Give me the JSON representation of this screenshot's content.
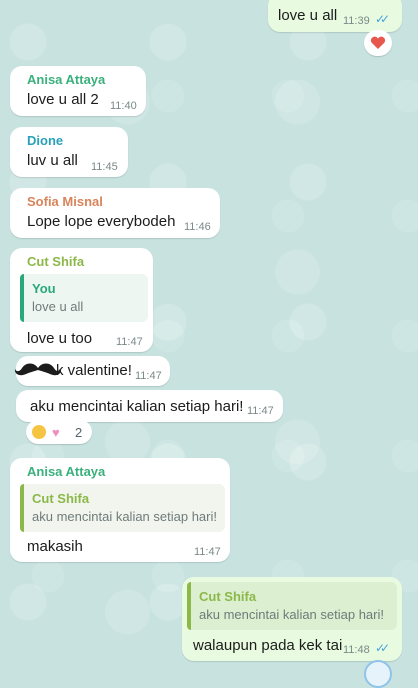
{
  "colors": {
    "wallpaper": "#c7e2df",
    "incoming_bubble": "#ffffff",
    "outgoing_bubble": "#e8fbe0",
    "anisa": "#3bb07c",
    "dione": "#2aa1b8",
    "sofia": "#d8845a",
    "cut_shifa": "#8cb84a",
    "you_quote": "#29a97b",
    "read_ticks": "#4aa3df"
  },
  "messages": [
    {
      "direction": "outgoing",
      "text": "love u all",
      "time": "11:39",
      "ticks": "read",
      "reaction": "heart"
    },
    {
      "direction": "incoming",
      "sender": "Anisa Attaya",
      "text": "love u all 2",
      "time": "11:40"
    },
    {
      "direction": "incoming",
      "sender": "Dione",
      "text": "luv u all",
      "time": "11:45"
    },
    {
      "direction": "incoming",
      "sender": "Sofia Misnal",
      "text": "Lope lope everybodeh",
      "time": "11:46"
    },
    {
      "direction": "incoming",
      "sender": "Cut Shifa",
      "quote": {
        "sender": "You",
        "text": "love u all"
      },
      "text": "love u too",
      "time": "11:47"
    },
    {
      "direction": "incoming",
      "text": "k valentine!",
      "time": "11:47",
      "sticker": "mustache-icon"
    },
    {
      "direction": "incoming",
      "text": "aku mencintai kalian setiap hari!",
      "time": "11:47",
      "reactions": [
        "laughing-emoji",
        "pink-heart-emoji"
      ],
      "reaction_count": "2"
    },
    {
      "direction": "incoming",
      "sender": "Anisa Attaya",
      "quote": {
        "sender": "Cut Shifa",
        "text": "aku mencintai kalian setiap hari!"
      },
      "text": "makasih",
      "time": "11:47"
    },
    {
      "direction": "outgoing",
      "quote": {
        "sender": "Cut Shifa",
        "text": "aku mencintai kalian setiap hari!"
      },
      "text": "walaupun pada kek tai",
      "time": "11:48",
      "ticks": "read"
    }
  ]
}
